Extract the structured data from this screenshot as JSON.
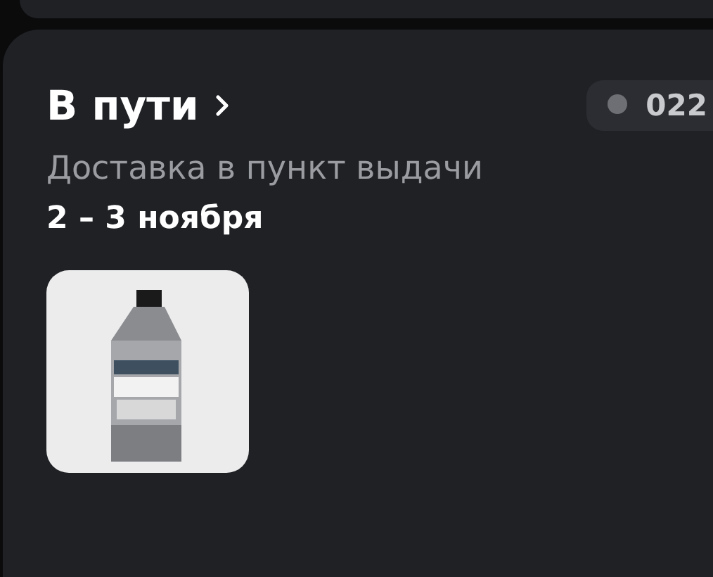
{
  "order": {
    "status": "В пути",
    "chat_badge": "022",
    "delivery_method": "Доставка в пункт выдачи",
    "delivery_dates": "2 – 3 ноября"
  }
}
